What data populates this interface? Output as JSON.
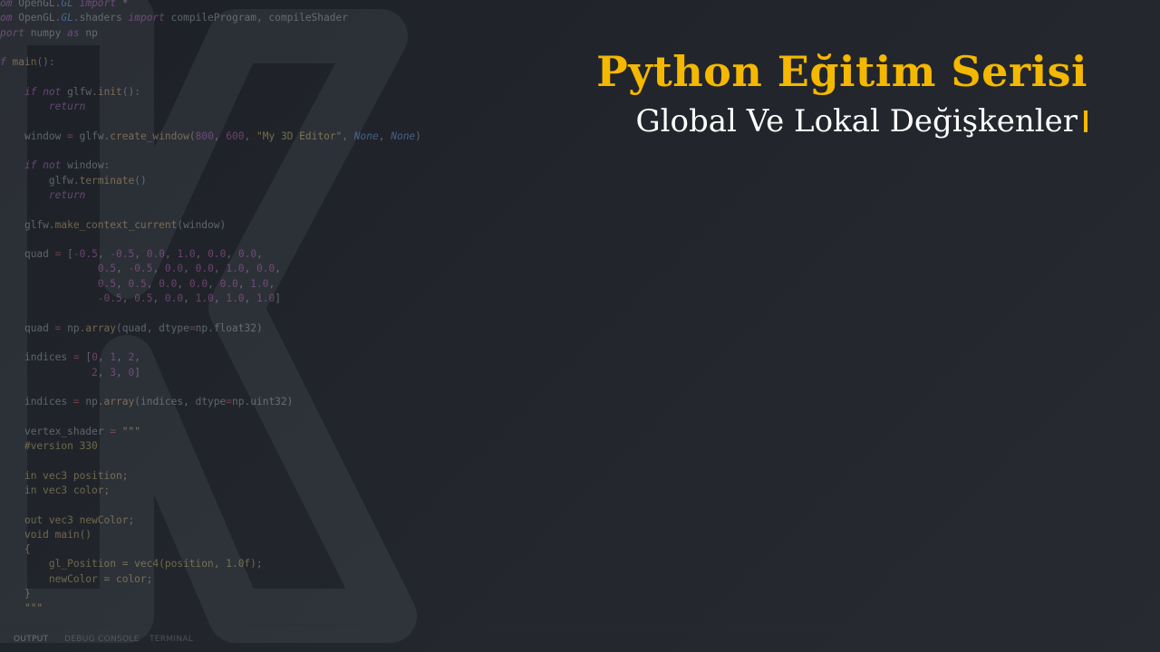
{
  "video": {
    "title": "Python Eğitim Serisi",
    "subtitle": "Global Ve Lokal Değişkenler",
    "accent_color": "#f5b800",
    "text_color": "#ffffff",
    "background_color": "#1f2227"
  },
  "panel": {
    "tabs": [
      "OUTPUT",
      "DEBUG CONSOLE",
      "TERMINAL"
    ],
    "active_tab": "OUTPUT"
  },
  "code_lines": [
    [
      [
        "om ",
        "kw"
      ],
      [
        "OpenGL.",
        "id"
      ],
      [
        "GL",
        "bi"
      ],
      [
        " import",
        "kw"
      ],
      [
        " *",
        "id"
      ]
    ],
    [
      [
        "om ",
        "kw"
      ],
      [
        "OpenGL.",
        "id"
      ],
      [
        "GL",
        "bi"
      ],
      [
        ".shaders ",
        "id"
      ],
      [
        "import",
        "kw"
      ],
      [
        " compileProgram, compileShader",
        "id"
      ]
    ],
    [
      [
        "port ",
        "kw"
      ],
      [
        "numpy ",
        "id"
      ],
      [
        "as",
        "kw"
      ],
      [
        " np",
        "id"
      ]
    ],
    [],
    [
      [
        "f ",
        "kw"
      ],
      [
        "main",
        "fn"
      ],
      [
        "():",
        "id"
      ]
    ],
    [],
    [
      [
        "    ",
        "id"
      ],
      [
        "if",
        "kw"
      ],
      [
        " ",
        "id"
      ],
      [
        "not",
        "kw"
      ],
      [
        " glfw.",
        "id"
      ],
      [
        "init",
        "fn"
      ],
      [
        "():",
        "id"
      ]
    ],
    [
      [
        "        ",
        "id"
      ],
      [
        "return",
        "kw"
      ]
    ],
    [],
    [
      [
        "    ",
        "id"
      ],
      [
        "window ",
        "id"
      ],
      [
        "=",
        "op"
      ],
      [
        " glfw.",
        "id"
      ],
      [
        "create_window",
        "fn"
      ],
      [
        "(",
        "id"
      ],
      [
        "800",
        "num"
      ],
      [
        ", ",
        "id"
      ],
      [
        "600",
        "num"
      ],
      [
        ", ",
        "id"
      ],
      [
        "\"My 3D Editor\"",
        "str"
      ],
      [
        ", ",
        "id"
      ],
      [
        "None",
        "bi"
      ],
      [
        ", ",
        "id"
      ],
      [
        "None",
        "bi"
      ],
      [
        ")",
        "id"
      ]
    ],
    [],
    [
      [
        "    ",
        "id"
      ],
      [
        "if",
        "kw"
      ],
      [
        " ",
        "id"
      ],
      [
        "not",
        "kw"
      ],
      [
        " window:",
        "id"
      ]
    ],
    [
      [
        "        ",
        "id"
      ],
      [
        "glfw.",
        "id"
      ],
      [
        "terminate",
        "fn"
      ],
      [
        "()",
        "id"
      ]
    ],
    [
      [
        "        ",
        "id"
      ],
      [
        "return",
        "kw"
      ]
    ],
    [],
    [
      [
        "    ",
        "id"
      ],
      [
        "glfw.",
        "id"
      ],
      [
        "make_context_current",
        "fn"
      ],
      [
        "(window)",
        "id"
      ]
    ],
    [],
    [
      [
        "    ",
        "id"
      ],
      [
        "quad ",
        "id"
      ],
      [
        "=",
        "op"
      ],
      [
        " [",
        "id"
      ],
      [
        "-0.5",
        "num"
      ],
      [
        ", ",
        "id"
      ],
      [
        "-0.5",
        "num"
      ],
      [
        ", ",
        "id"
      ],
      [
        "0.0",
        "num"
      ],
      [
        ", ",
        "id"
      ],
      [
        "1.0",
        "num"
      ],
      [
        ", ",
        "id"
      ],
      [
        "0.0",
        "num"
      ],
      [
        ", ",
        "id"
      ],
      [
        "0.0",
        "num"
      ],
      [
        ",",
        "id"
      ]
    ],
    [
      [
        "                ",
        "id"
      ],
      [
        "0.5",
        "num"
      ],
      [
        ", ",
        "id"
      ],
      [
        "-0.5",
        "num"
      ],
      [
        ", ",
        "id"
      ],
      [
        "0.0",
        "num"
      ],
      [
        ", ",
        "id"
      ],
      [
        "0.0",
        "num"
      ],
      [
        ", ",
        "id"
      ],
      [
        "1.0",
        "num"
      ],
      [
        ", ",
        "id"
      ],
      [
        "0.0",
        "num"
      ],
      [
        ",",
        "id"
      ]
    ],
    [
      [
        "                ",
        "id"
      ],
      [
        "0.5",
        "num"
      ],
      [
        ", ",
        "id"
      ],
      [
        "0.5",
        "num"
      ],
      [
        ", ",
        "id"
      ],
      [
        "0.0",
        "num"
      ],
      [
        ", ",
        "id"
      ],
      [
        "0.0",
        "num"
      ],
      [
        ", ",
        "id"
      ],
      [
        "0.0",
        "num"
      ],
      [
        ", ",
        "id"
      ],
      [
        "1.0",
        "num"
      ],
      [
        ",",
        "id"
      ]
    ],
    [
      [
        "                ",
        "id"
      ],
      [
        "-0.5",
        "num"
      ],
      [
        ", ",
        "id"
      ],
      [
        "0.5",
        "num"
      ],
      [
        ", ",
        "id"
      ],
      [
        "0.0",
        "num"
      ],
      [
        ", ",
        "id"
      ],
      [
        "1.0",
        "num"
      ],
      [
        ", ",
        "id"
      ],
      [
        "1.0",
        "num"
      ],
      [
        ", ",
        "id"
      ],
      [
        "1.0",
        "num"
      ],
      [
        "]",
        "id"
      ]
    ],
    [],
    [
      [
        "    ",
        "id"
      ],
      [
        "quad ",
        "id"
      ],
      [
        "=",
        "op"
      ],
      [
        " np.",
        "id"
      ],
      [
        "array",
        "fn"
      ],
      [
        "(quad, dtype",
        "id"
      ],
      [
        "=",
        "op"
      ],
      [
        "np.float32)",
        "id"
      ]
    ],
    [],
    [
      [
        "    ",
        "id"
      ],
      [
        "indices ",
        "id"
      ],
      [
        "=",
        "op"
      ],
      [
        " [",
        "id"
      ],
      [
        "0",
        "num"
      ],
      [
        ", ",
        "id"
      ],
      [
        "1",
        "num"
      ],
      [
        ", ",
        "id"
      ],
      [
        "2",
        "num"
      ],
      [
        ",",
        "id"
      ]
    ],
    [
      [
        "               ",
        "id"
      ],
      [
        "2",
        "num"
      ],
      [
        ", ",
        "id"
      ],
      [
        "3",
        "num"
      ],
      [
        ", ",
        "id"
      ],
      [
        "0",
        "num"
      ],
      [
        "]",
        "id"
      ]
    ],
    [],
    [
      [
        "    ",
        "id"
      ],
      [
        "indices ",
        "id"
      ],
      [
        "=",
        "op"
      ],
      [
        " np.",
        "id"
      ],
      [
        "array",
        "fn"
      ],
      [
        "(indices, dtype",
        "id"
      ],
      [
        "=",
        "op"
      ],
      [
        "np.uint32)",
        "id"
      ]
    ],
    [],
    [
      [
        "    ",
        "id"
      ],
      [
        "vertex_shader ",
        "id"
      ],
      [
        "=",
        "op"
      ],
      [
        " ",
        "id"
      ],
      [
        "\"\"\"",
        "str"
      ]
    ],
    [
      [
        "    ",
        "id"
      ],
      [
        "#version 330",
        "gl"
      ]
    ],
    [],
    [
      [
        "    ",
        "id"
      ],
      [
        "in vec3 position;",
        "gl"
      ]
    ],
    [
      [
        "    ",
        "id"
      ],
      [
        "in vec3 color;",
        "gl"
      ]
    ],
    [],
    [
      [
        "    ",
        "id"
      ],
      [
        "out vec3 newColor;",
        "gl"
      ]
    ],
    [
      [
        "    ",
        "id"
      ],
      [
        "void main()",
        "gl"
      ]
    ],
    [
      [
        "    ",
        "id"
      ],
      [
        "{",
        "gl"
      ]
    ],
    [
      [
        "        ",
        "id"
      ],
      [
        "gl_Position = vec4(position, 1.0f);",
        "gl"
      ]
    ],
    [
      [
        "        ",
        "id"
      ],
      [
        "newColor = color;",
        "gl"
      ]
    ],
    [
      [
        "    ",
        "id"
      ],
      [
        "}",
        "gl"
      ]
    ],
    [
      [
        "    ",
        "id"
      ],
      [
        "\"\"\"",
        "str"
      ]
    ]
  ]
}
